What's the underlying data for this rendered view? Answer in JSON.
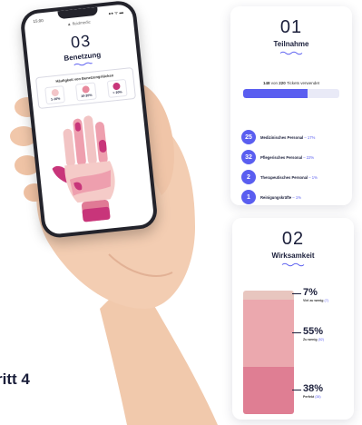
{
  "phone": {
    "status_time": "15:00",
    "status_icons": "●● ᯤ ▬",
    "url": "▲ fluidmedic",
    "step_number": "03",
    "title": "Benetzung",
    "frequency_title": "Häufigkeit von Benetzungslücken",
    "frequency_levels": [
      {
        "label": "1-10%",
        "color": "#f3c6c9"
      },
      {
        "label": "10-20%",
        "color": "#e88a9e"
      },
      {
        "label": "> 20%",
        "color": "#c8357a"
      }
    ]
  },
  "participation": {
    "step_number": "01",
    "title": "Teilnahme",
    "tickets_used": "148",
    "tickets_of": "von",
    "tickets_total": "220",
    "tickets_label": "Tickets verwendet",
    "progress_fraction": 0.67,
    "groups": [
      {
        "count": "25",
        "label": "Medizinisches Personal",
        "pct": " – 17%"
      },
      {
        "count": "32",
        "label": "Pflegerisches Personal",
        "pct": " – 22%"
      },
      {
        "count": "2",
        "label": "Therapeutisches Personal",
        "pct": " – 1%"
      },
      {
        "count": "1",
        "label": "Reinigungskräfte",
        "pct": " – 1%"
      }
    ]
  },
  "effectiveness": {
    "step_number": "02",
    "title": "Wirksamkeit",
    "segments": [
      {
        "value": "7%",
        "label": "Viel zu wenig",
        "count": "(7)",
        "fraction": 0.07,
        "color": "#e8c6bf"
      },
      {
        "value": "55%",
        "label": "Zu wenig",
        "count": "(52)",
        "fraction": 0.55,
        "color": "#eba8ae"
      },
      {
        "value": "38%",
        "label": "Perfekt",
        "count": "(38)",
        "fraction": 0.38,
        "color": "#df7e93"
      }
    ]
  },
  "footer": {
    "step_label": "ritt 4"
  },
  "colors": {
    "accent": "#5a5ef0",
    "dark": "#1b1f3b"
  }
}
